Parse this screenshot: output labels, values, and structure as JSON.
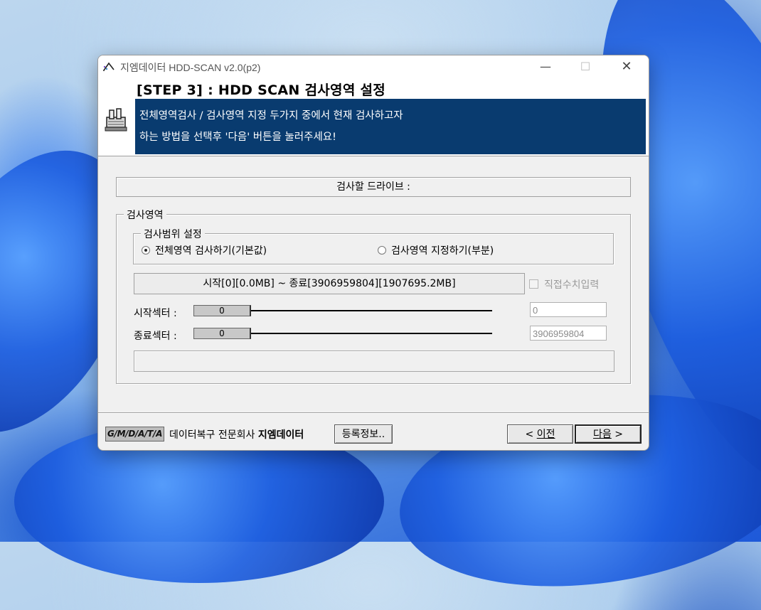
{
  "window": {
    "title": "지엠데이터 HDD-SCAN v2.0(p2)",
    "minimize_glyph": "—",
    "maximize_glyph": "☐",
    "close_glyph": "✕"
  },
  "header": {
    "step_title": "[STEP 3] : HDD SCAN 검사영역 설정",
    "info_line1": "전체영역검사 / 검사영역 지정 두가지 중에서 현재 검사하고자",
    "info_line2": "하는 방법을 선택후 '다음' 버튼을 눌러주세요!",
    "info_bg": "#093b6f",
    "icon": "hdd-tool-icon"
  },
  "drive": {
    "label": "검사할 드라이브 :"
  },
  "scan_area": {
    "group_label": "검사영역",
    "range_group_label": "검사범위 설정",
    "radio_full": {
      "label": "전체영역 검사하기(기본값)",
      "selected": true
    },
    "radio_partial": {
      "label": "검사영역 지정하기(부분)",
      "selected": false
    },
    "range_text": "시작[0][0.0MB] ~ 종료[3906959804][1907695.2MB]",
    "manual_input_label": "직접수치입력",
    "manual_input_checked": false,
    "start_sector": {
      "label": "시작섹터 :",
      "slider_value": "0",
      "field_value": "0"
    },
    "end_sector": {
      "label": "종료섹터 :",
      "slider_value": "0",
      "field_value": "3906959804"
    }
  },
  "footer": {
    "logo": "G/M/D/A/T/A",
    "company_prefix": "데이터복구 전문회사",
    "company_name": "지엠데이터",
    "register_button": "등록정보..",
    "prev_prefix": "< ",
    "prev_label": "이전",
    "next_label": "다음",
    "next_suffix": " >"
  }
}
